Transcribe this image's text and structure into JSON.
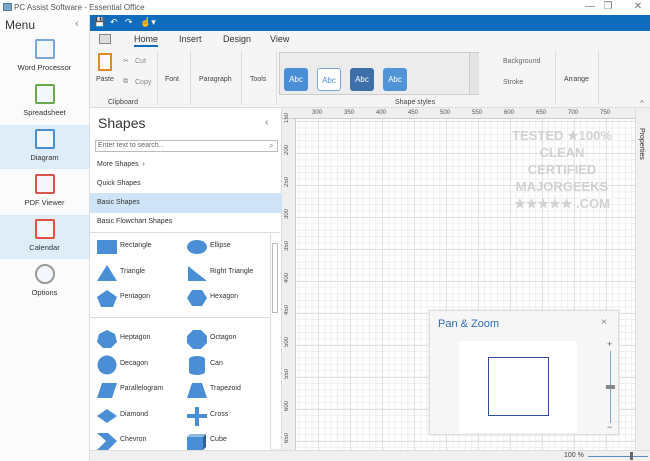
{
  "window": {
    "title": "PC Assist Software - Essential Office",
    "minimize": "—",
    "restore": "❐",
    "close": "✕"
  },
  "menu": {
    "title": "Menu",
    "collapse": "‹",
    "items": [
      {
        "label": "Word Processor",
        "icon": "word-processor-icon",
        "selected": false
      },
      {
        "label": "Spreadsheet",
        "icon": "spreadsheet-icon",
        "selected": false
      },
      {
        "label": "Diagram",
        "icon": "diagram-icon",
        "selected": true
      },
      {
        "label": "PDF Viewer",
        "icon": "pdf-viewer-icon",
        "selected": false
      },
      {
        "label": "Calendar",
        "icon": "calendar-icon",
        "selected": true
      },
      {
        "label": "Options",
        "icon": "gear-icon",
        "selected": false
      }
    ]
  },
  "ribbon": {
    "tabs": [
      "Home",
      "Insert",
      "Design",
      "View"
    ],
    "active_tab": "Home",
    "clipboard": {
      "paste": "Paste",
      "cut": "Cut",
      "copy": "Copy",
      "group": "Clipboard"
    },
    "font": "Font",
    "paragraph": "Paragraph",
    "tools": "Tools",
    "shape_styles": {
      "samples": [
        "Abc",
        "Abc",
        "Abc",
        "Abc"
      ],
      "group": "Shape styles",
      "background": "Background",
      "stroke": "Stroke"
    },
    "arrange": "Arrange"
  },
  "shapes_panel": {
    "title": "Shapes",
    "collapse": "‹",
    "search_placeholder": "Enter text to search...",
    "categories": [
      "More Shapes",
      "Quick Shapes",
      "Basic Shapes",
      "Basic Flowchart Shapes"
    ],
    "selected_category": "Basic Shapes",
    "quick": [
      "Rectangle",
      "Ellipse",
      "Triangle",
      "Right Triangle",
      "Pentagon",
      "Hexagon"
    ],
    "basic": [
      "Heptagon",
      "Octagon",
      "Decagon",
      "Can",
      "Parallelogram",
      "Trapezoid",
      "Diamond",
      "Cross",
      "Chevron",
      "Cube"
    ]
  },
  "rulers": {
    "horizontal": [
      "300",
      "350",
      "400",
      "450",
      "500",
      "550",
      "600",
      "650",
      "700",
      "750"
    ],
    "vertical": [
      "150",
      "200",
      "250",
      "300",
      "350",
      "400",
      "450",
      "500",
      "550",
      "600",
      "650"
    ]
  },
  "properties_label": "Properties",
  "watermark": "TESTED ★ 100% CLEAN CERTIFIED MAJORGEEKS ★★★★★ .COM",
  "pan_zoom": {
    "title": "Pan & Zoom",
    "close": "×",
    "plus": "+",
    "minus": "−",
    "zoom_level": 0.5
  },
  "status": {
    "zoom": "100 %",
    "zoom_level": 0.7
  },
  "colors": {
    "accent": "#0f6cbd",
    "shape": "#4a8fd6"
  }
}
